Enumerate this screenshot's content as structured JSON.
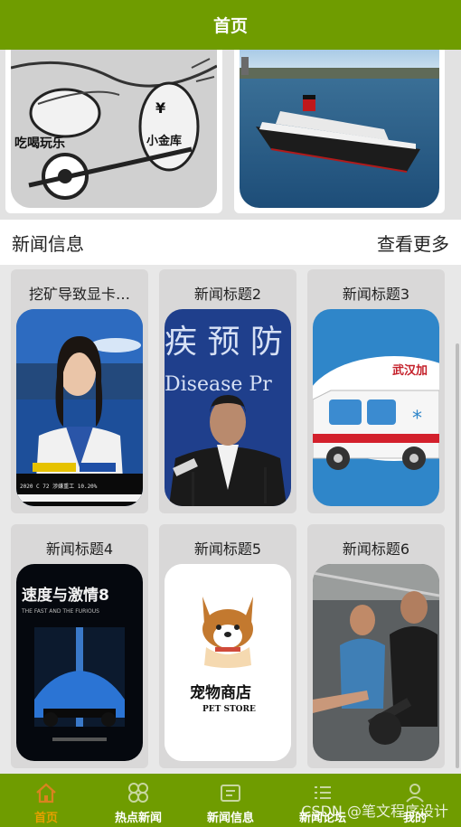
{
  "header": {
    "title": "首页"
  },
  "banner": {
    "slides": [
      {
        "caption": "吃喝玩乐",
        "coin_text": "小金库",
        "currency": "¥"
      },
      {
        "caption": ""
      }
    ]
  },
  "news_section": {
    "title": "新闻信息",
    "more_label": "查看更多"
  },
  "news": [
    {
      "title": "挖矿导致显卡…",
      "image": "news-anchor",
      "ticker": "2020 C 72   涉嫌重工 10.20%"
    },
    {
      "title": "新闻标题2",
      "image": "press-conference",
      "backdrop": "疾 预 防",
      "backdrop_en": "Disease  Pr"
    },
    {
      "title": "新闻标题3",
      "image": "ambulance",
      "tag": "武汉加"
    },
    {
      "title": "新闻标题4",
      "image": "movie-poster",
      "poster_title": "速度与激情8",
      "poster_sub": "THE FAST AND THE FURIOUS"
    },
    {
      "title": "新闻标题5",
      "image": "pet-store-logo",
      "store_name": "宠物商店",
      "store_en": "PET STORE"
    },
    {
      "title": "新闻标题6",
      "image": "gym"
    }
  ],
  "tabbar": {
    "items": [
      {
        "label": "首页",
        "icon": "home-icon",
        "active": true
      },
      {
        "label": "热点新闻",
        "icon": "hot-news-icon",
        "active": false
      },
      {
        "label": "新闻信息",
        "icon": "news-info-icon",
        "active": false
      },
      {
        "label": "新闻论坛",
        "icon": "forum-icon",
        "active": false
      },
      {
        "label": "我的",
        "icon": "profile-icon",
        "active": false
      }
    ]
  },
  "watermark": "CSDN @笔文程序设计",
  "colors": {
    "brand": "#6f9c00",
    "active_tab": "#e4a000"
  }
}
